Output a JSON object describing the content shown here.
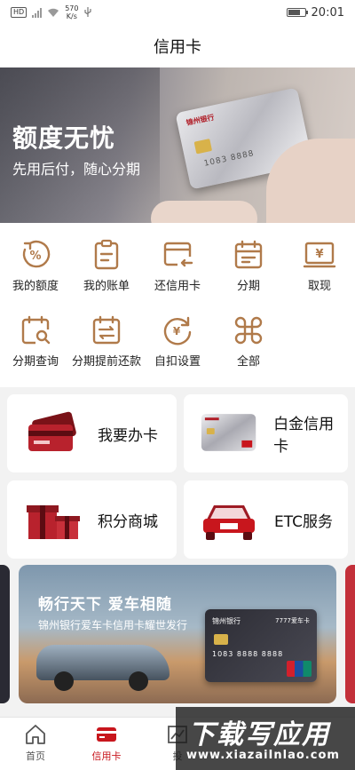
{
  "status_bar": {
    "network_badge": "HD",
    "speed_value": "570",
    "speed_unit": "K/s",
    "time": "20:01",
    "battery_level": 0.75
  },
  "header": {
    "title": "信用卡"
  },
  "banner": {
    "title": "额度无忧",
    "subtitle": "先用后付，随心分期"
  },
  "services": [
    {
      "label": "我的额度",
      "icon": "percent-circle-icon"
    },
    {
      "label": "我的账单",
      "icon": "clipboard-icon"
    },
    {
      "label": "还信用卡",
      "icon": "card-repay-icon"
    },
    {
      "label": "分期",
      "icon": "calendar-icon"
    },
    {
      "label": "取现",
      "icon": "cash-withdraw-icon"
    },
    {
      "label": "分期查询",
      "icon": "calendar-search-icon"
    },
    {
      "label": "分期提前还款",
      "icon": "calendar-exchange-icon"
    },
    {
      "label": "自扣设置",
      "icon": "yen-refresh-icon"
    },
    {
      "label": "全部",
      "icon": "command-icon"
    }
  ],
  "quick_cards": [
    {
      "label": "我要办卡",
      "icon": "cards-stack-icon"
    },
    {
      "label": "白金信用卡",
      "icon": "platinum-card-icon"
    },
    {
      "label": "积分商城",
      "icon": "gift-box-icon"
    },
    {
      "label": "ETC服务",
      "icon": "car-icon"
    }
  ],
  "promo": {
    "title": "畅行天下 爱车相随",
    "subtitle": "锦州银行爱车卡信用卡耀世发行",
    "card_bank": "锦州银行",
    "card_tag": "7777爱车卡",
    "card_number": "1083 8888 8888"
  },
  "banner_card": {
    "bank": "锦州银行",
    "number": "1083 8888"
  },
  "tabs": [
    {
      "label": "首页",
      "icon": "home-icon",
      "active": false
    },
    {
      "label": "信用卡",
      "icon": "credit-card-icon",
      "active": true
    },
    {
      "label": "投",
      "icon": "chart-icon",
      "active": false
    }
  ],
  "watermark": {
    "title": "下载写应用",
    "url": "www.xiazaiInlao.com"
  },
  "colors": {
    "accent": "#c8161d",
    "icon_brown": "#b07a4a",
    "background": "#f2f2f2"
  }
}
